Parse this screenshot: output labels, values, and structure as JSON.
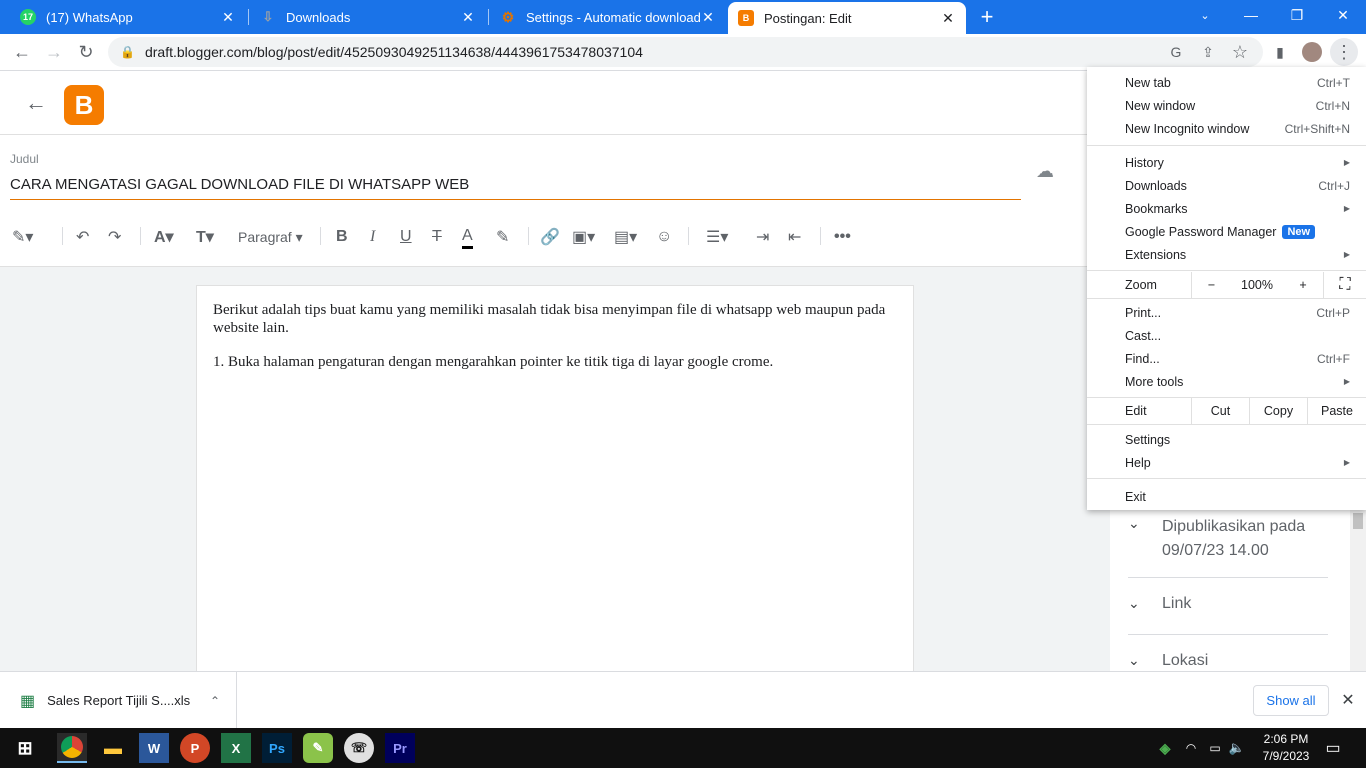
{
  "tabs": [
    {
      "title": "(17) WhatsApp",
      "badge": "17"
    },
    {
      "title": "Downloads"
    },
    {
      "title": "Settings - Automatic downloads"
    },
    {
      "title": "Postingan: Edit"
    }
  ],
  "address": {
    "url": "draft.blogger.com/blog/post/edit/4525093049251134638/4443961753478037104"
  },
  "editor": {
    "title_label": "Judul",
    "title_value": "CARA MENGATASI GAGAL DOWNLOAD FILE DI WHATSAPP WEB",
    "paragraph_style": "Paragraf",
    "body": [
      "Berikut adalah tips buat kamu yang memiliki masalah tidak bisa menyimpan file di whatsapp web maupun pada website lain.",
      "1. Buka halaman pengaturan dengan mengarahkan pointer ke titik tiga di layar google crome."
    ]
  },
  "sidebar": {
    "published_label": "Dipublikasikan pada",
    "published_date": "09/07/23 14.00",
    "link": "Link",
    "location": "Lokasi"
  },
  "menu": {
    "new_tab": "New tab",
    "new_tab_sc": "Ctrl+T",
    "new_window": "New window",
    "new_window_sc": "Ctrl+N",
    "incognito": "New Incognito window",
    "incognito_sc": "Ctrl+Shift+N",
    "history": "History",
    "downloads": "Downloads",
    "downloads_sc": "Ctrl+J",
    "bookmarks": "Bookmarks",
    "password_manager": "Google Password Manager",
    "new_badge": "New",
    "extensions": "Extensions",
    "zoom": "Zoom",
    "zoom_minus": "−",
    "zoom_level": "100%",
    "zoom_plus": "+",
    "print": "Print...",
    "print_sc": "Ctrl+P",
    "cast": "Cast...",
    "find": "Find...",
    "find_sc": "Ctrl+F",
    "more_tools": "More tools",
    "edit": "Edit",
    "cut": "Cut",
    "copy": "Copy",
    "paste": "Paste",
    "settings": "Settings",
    "help": "Help",
    "exit": "Exit"
  },
  "download_bar": {
    "file_name": "Sales Report Tijili S....xls",
    "show_all": "Show all"
  },
  "taskbar": {
    "time": "2:06 PM",
    "date": "7/9/2023"
  },
  "colors": {
    "chrome_blue": "#1a73e8",
    "blogger_orange": "#f57c00"
  }
}
